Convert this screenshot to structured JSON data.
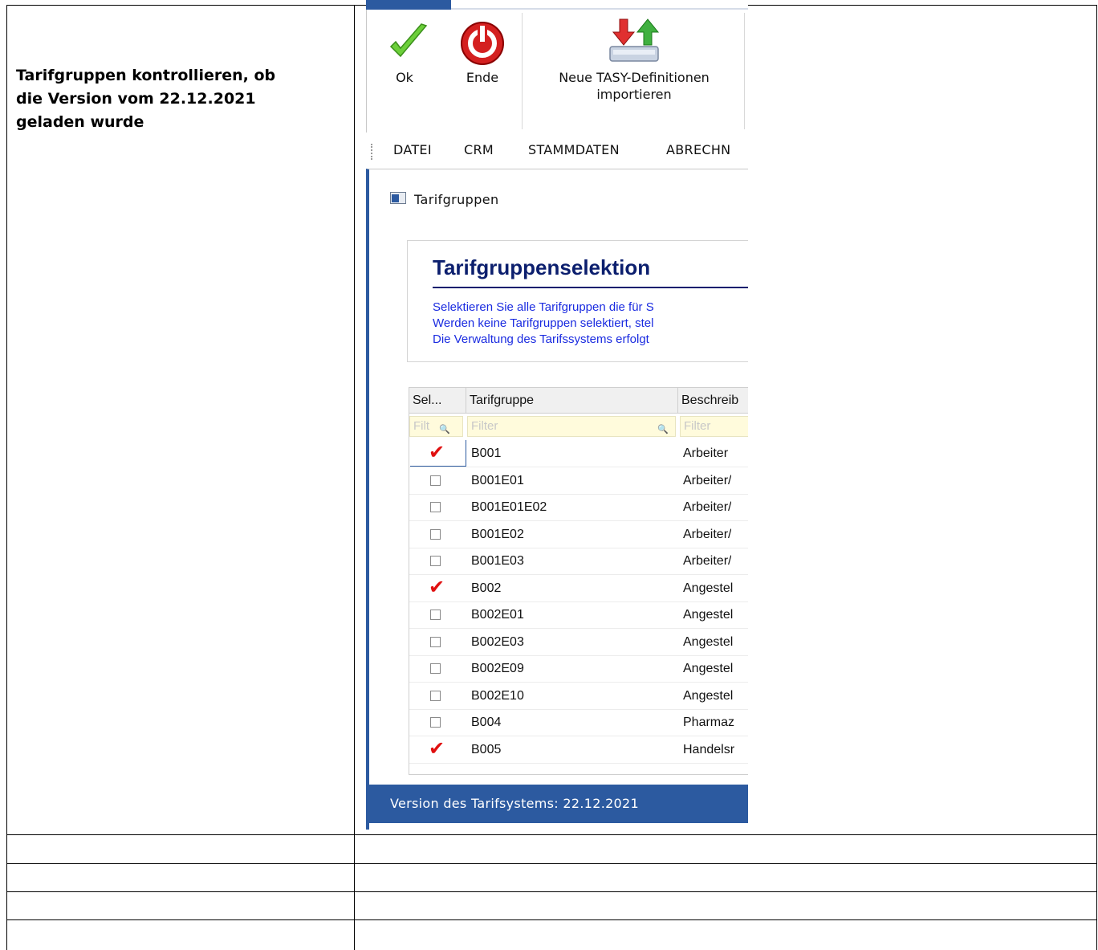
{
  "document": {
    "instruction": "Tarifgruppen kontrollieren, ob\ndie Version vom 22.12.2021\ngeladen wurde"
  },
  "ribbon": {
    "ok_label": "Ok",
    "ende_label": "Ende",
    "import_label": "Neue TASY-Definitionen\nimportieren"
  },
  "menu": [
    "DATEI",
    "CRM",
    "STAMMDATEN",
    "ABRECHN"
  ],
  "window": {
    "title": "Tarifgruppen"
  },
  "selection": {
    "title": "Tarifgruppenselektion",
    "lines": [
      "Selektieren Sie alle Tarifgruppen die für S",
      "Werden keine Tarifgruppen selektiert, stel",
      "Die Verwaltung des Tarifssystems erfolgt"
    ]
  },
  "grid": {
    "columns": [
      "Sel...",
      "Tarifgruppe",
      "Beschreib"
    ],
    "filter_placeholders": [
      "Filt",
      "Filter",
      "Filter"
    ],
    "rows": [
      {
        "selected": true,
        "tarifgruppe": "B001",
        "beschreibung": "Arbeiter"
      },
      {
        "selected": false,
        "tarifgruppe": "B001E01",
        "beschreibung": "Arbeiter/"
      },
      {
        "selected": false,
        "tarifgruppe": "B001E01E02",
        "beschreibung": "Arbeiter/"
      },
      {
        "selected": false,
        "tarifgruppe": "B001E02",
        "beschreibung": "Arbeiter/"
      },
      {
        "selected": false,
        "tarifgruppe": "B001E03",
        "beschreibung": "Arbeiter/"
      },
      {
        "selected": true,
        "tarifgruppe": "B002",
        "beschreibung": "Angestel"
      },
      {
        "selected": false,
        "tarifgruppe": "B002E01",
        "beschreibung": "Angestel"
      },
      {
        "selected": false,
        "tarifgruppe": "B002E03",
        "beschreibung": "Angestel"
      },
      {
        "selected": false,
        "tarifgruppe": "B002E09",
        "beschreibung": "Angestel"
      },
      {
        "selected": false,
        "tarifgruppe": "B002E10",
        "beschreibung": "Angestel"
      },
      {
        "selected": false,
        "tarifgruppe": "B004",
        "beschreibung": "Pharmaz"
      },
      {
        "selected": true,
        "tarifgruppe": "B005",
        "beschreibung": "Handelsr"
      }
    ]
  },
  "status": {
    "text": "Version des Tarifsystems: 22.12.2021"
  },
  "colors": {
    "accent": "#2c5aa0",
    "title_blue": "#0c1f6e",
    "text_blue": "#1a2be0",
    "check_red": "#e01010",
    "filter_bg": "#fffbdc"
  }
}
